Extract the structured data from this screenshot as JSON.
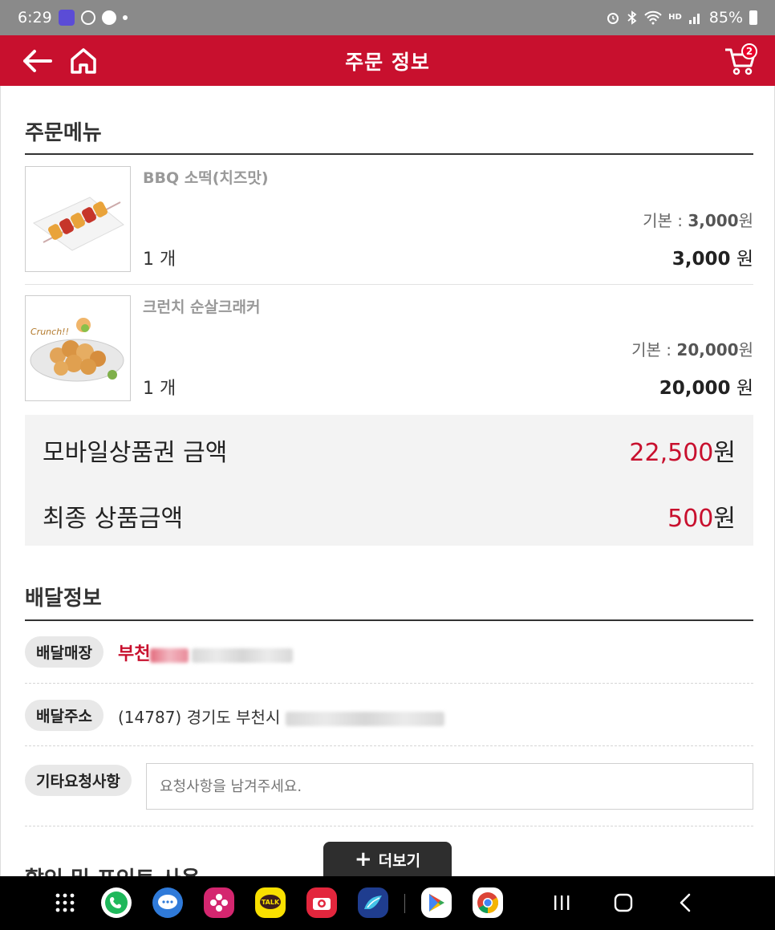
{
  "status_bar": {
    "time": "6:29",
    "battery": "85%",
    "network_label": "HD"
  },
  "header": {
    "title": "주문 정보",
    "cart_count": "2"
  },
  "order_section": {
    "title": "주문메뉴",
    "items": [
      {
        "name": "BBQ 소떡(치즈맛)",
        "qty": "1 개",
        "base_label": "기본 : ",
        "base_value": "3,000",
        "base_unit": "원",
        "total_value": "3,000",
        "total_unit": " 원",
        "thumb_icon": "skewer-food-image"
      },
      {
        "name": "크런치 순살크래커",
        "qty": "1 개",
        "base_label": "기본 : ",
        "base_value": "20,000",
        "base_unit": "원",
        "total_value": "20,000",
        "total_unit": " 원",
        "thumb_icon": "fried-chicken-image"
      }
    ]
  },
  "summary": {
    "voucher_label": "모바일상품권 금액",
    "voucher_value": "22,500",
    "voucher_unit": "원",
    "final_label": "최종 상품금액",
    "final_value": "500",
    "final_unit": "원"
  },
  "delivery_section": {
    "title": "배달정보",
    "store_label": "배달매장",
    "store_name": "부천",
    "address_label": "배달주소",
    "address_text": "(14787) 경기도 부천시",
    "request_label": "기타요청사항",
    "request_placeholder": "요청사항을 남겨주세요.",
    "request_value": ""
  },
  "next_section": {
    "title": "할인 및 포인트 사용"
  },
  "more_button": {
    "label": "더보기"
  },
  "colors": {
    "brand_red": "#c8102e",
    "status_bar": "#8a8a8a",
    "summary_bg": "#f3f3f3"
  }
}
